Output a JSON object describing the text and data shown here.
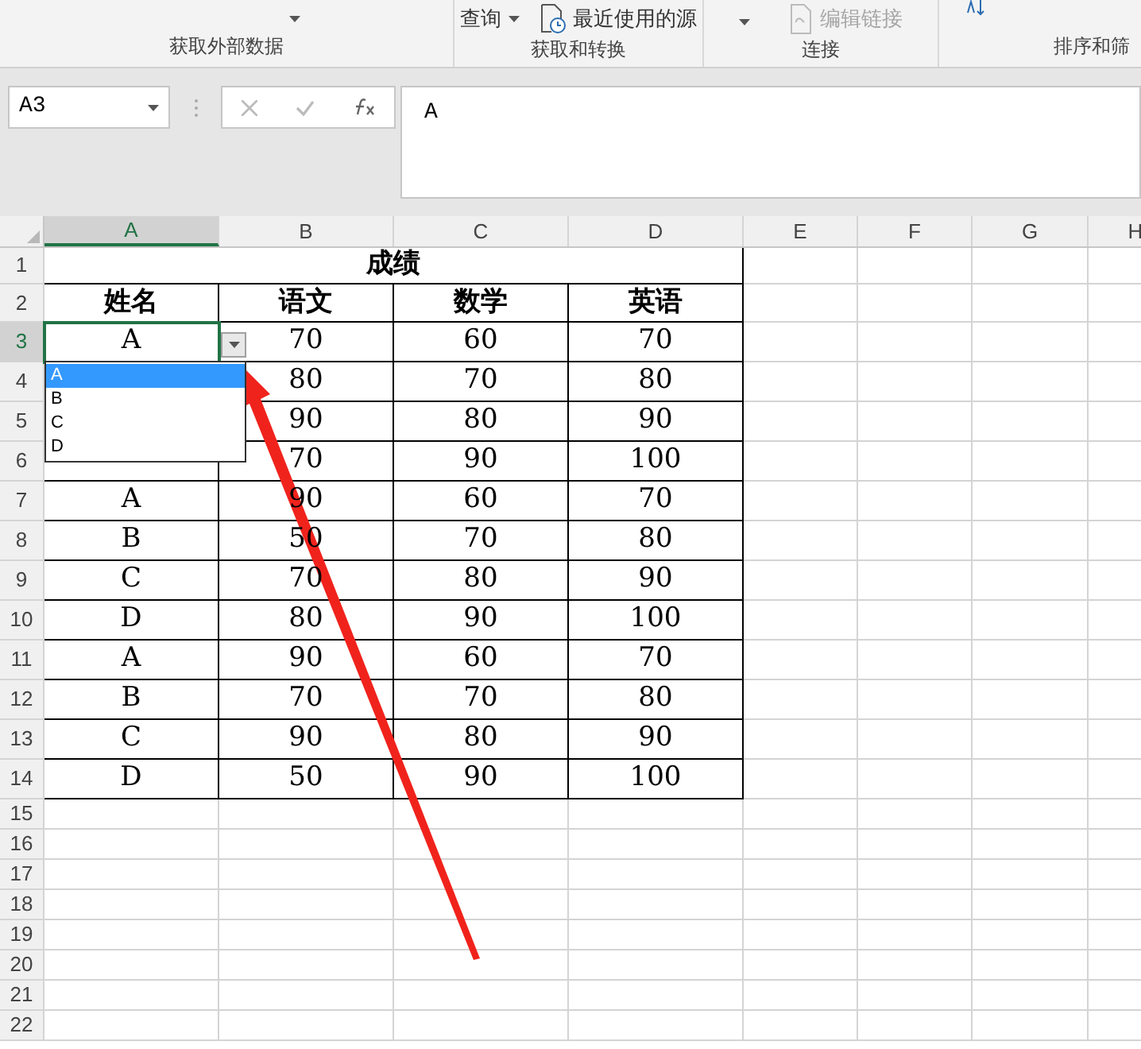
{
  "ribbon": {
    "items": [
      {
        "kind": "query",
        "label": "查询"
      },
      {
        "kind": "recent",
        "label": "最近使用的源"
      },
      {
        "kind": "links",
        "label": "编辑链接",
        "disabled": true
      }
    ],
    "groups": [
      "获取外部数据",
      "获取和转换",
      "连接",
      "排序和筛"
    ]
  },
  "formula_bar": {
    "name_box": "A3",
    "value": "A"
  },
  "columns": [
    {
      "label": "A",
      "selected": true
    },
    {
      "label": "B",
      "selected": false
    },
    {
      "label": "C",
      "selected": false
    },
    {
      "label": "D",
      "selected": false
    },
    {
      "label": "E",
      "selected": false
    },
    {
      "label": "F",
      "selected": false
    },
    {
      "label": "G",
      "selected": false
    },
    {
      "label": "H",
      "selected": false
    }
  ],
  "row_numbers": [
    {
      "label": "1",
      "selected": false
    },
    {
      "label": "2",
      "selected": false
    },
    {
      "label": "3",
      "selected": true
    },
    {
      "label": "4",
      "selected": false
    },
    {
      "label": "5",
      "selected": false
    },
    {
      "label": "6",
      "selected": false
    },
    {
      "label": "7",
      "selected": false
    },
    {
      "label": "8",
      "selected": false
    },
    {
      "label": "9",
      "selected": false
    },
    {
      "label": "10",
      "selected": false
    },
    {
      "label": "11",
      "selected": false
    },
    {
      "label": "12",
      "selected": false
    },
    {
      "label": "13",
      "selected": false
    },
    {
      "label": "14",
      "selected": false
    },
    {
      "label": "15",
      "selected": false
    },
    {
      "label": "16",
      "selected": false
    },
    {
      "label": "17",
      "selected": false
    },
    {
      "label": "18",
      "selected": false
    },
    {
      "label": "19",
      "selected": false
    },
    {
      "label": "20",
      "selected": false
    },
    {
      "label": "21",
      "selected": false
    },
    {
      "label": "22",
      "selected": false
    }
  ],
  "table": {
    "title": "成绩",
    "headers": [
      "姓名",
      "语文",
      "数学",
      "英语"
    ],
    "rows": [
      {
        "cells": [
          "A",
          "70",
          "60",
          "70"
        ]
      },
      {
        "cells": [
          null,
          "80",
          "70",
          "80"
        ]
      },
      {
        "cells": [
          null,
          "90",
          "80",
          "90"
        ]
      },
      {
        "cells": [
          null,
          "70",
          "90",
          "100"
        ]
      },
      {
        "cells": [
          "A",
          "90",
          "60",
          "70"
        ]
      },
      {
        "cells": [
          "B",
          "50",
          "70",
          "80"
        ]
      },
      {
        "cells": [
          "C",
          "70",
          "80",
          "90"
        ]
      },
      {
        "cells": [
          "D",
          "80",
          "90",
          "100"
        ]
      },
      {
        "cells": [
          "A",
          "90",
          "60",
          "70"
        ]
      },
      {
        "cells": [
          "B",
          "70",
          "70",
          "80"
        ]
      },
      {
        "cells": [
          "C",
          "90",
          "80",
          "90"
        ]
      },
      {
        "cells": [
          "D",
          "50",
          "90",
          "100"
        ]
      }
    ]
  },
  "dropdown": {
    "options": [
      {
        "label": "A",
        "selected": true
      },
      {
        "label": "B",
        "selected": false
      },
      {
        "label": "C",
        "selected": false
      },
      {
        "label": "D",
        "selected": false
      }
    ]
  }
}
